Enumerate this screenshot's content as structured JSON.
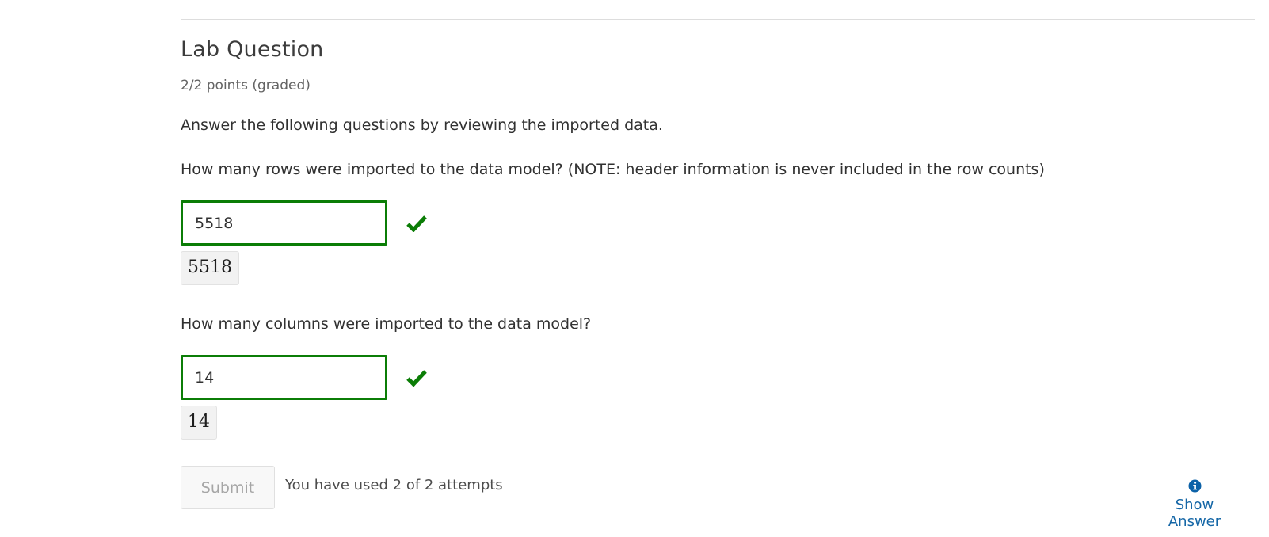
{
  "problem": {
    "title": "Lab Question",
    "points": "2/2 points (graded)",
    "intro": "Answer the following questions by reviewing the imported data."
  },
  "questions": [
    {
      "prompt": "How many rows were imported to the data model? (NOTE: header information is never included in the row counts)",
      "answer_value": "5518",
      "preview": "5518",
      "status": "correct"
    },
    {
      "prompt": "How many columns were imported to the data model?",
      "answer_value": "14",
      "preview": "14",
      "status": "correct"
    }
  ],
  "actions": {
    "submit_label": "Submit",
    "attempts_text": "You have used 2 of 2 attempts",
    "show_answer_label": "Show Answer"
  },
  "icons": {
    "correct": "checkmark-icon",
    "info": "info-circle-icon"
  },
  "colors": {
    "correct_green": "#0b7d06",
    "link_blue": "#1466a6",
    "submit_disabled_text": "#a6a6a6"
  }
}
